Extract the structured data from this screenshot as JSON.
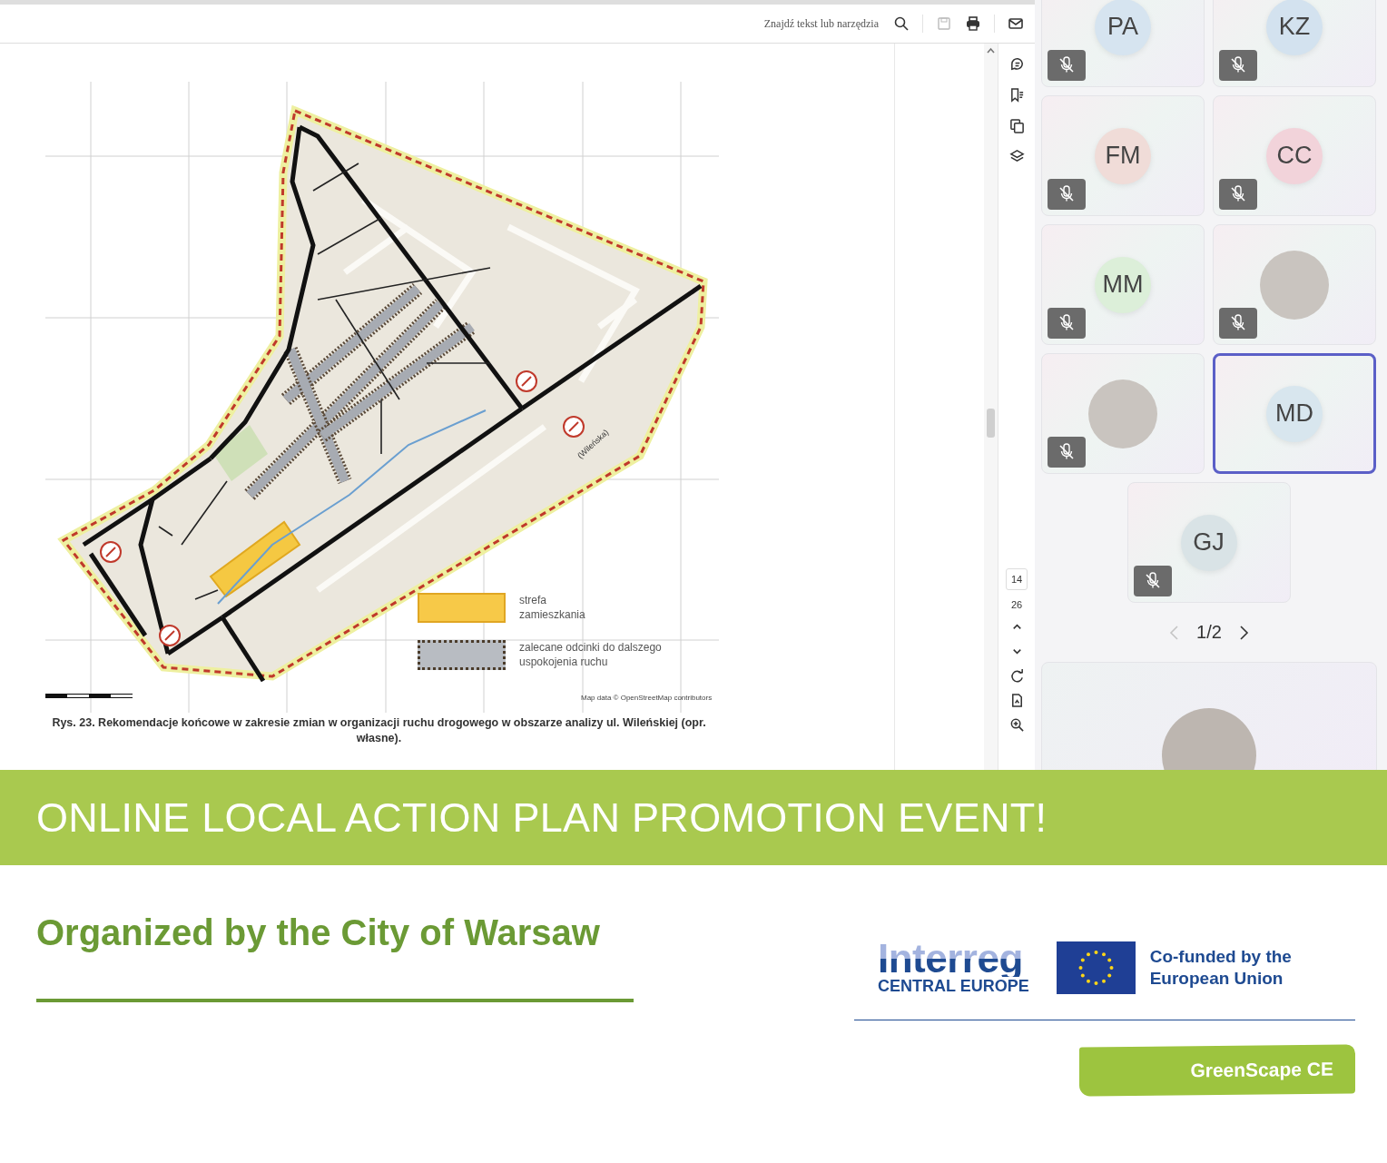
{
  "pdf_viewer": {
    "toolbar": {
      "search_placeholder": "Znajdź tekst lub narzędzia"
    },
    "page_number": "14",
    "page_count": "26",
    "figure": {
      "map_label": "(Wileńska)",
      "legend": [
        {
          "kind": "zone",
          "label": "strefa zamieszkania"
        },
        {
          "kind": "calming",
          "label": "zalecane odcinki do dalszego uspokojenia ruchu"
        }
      ],
      "attribution": "Map data © OpenStreetMap contributors",
      "caption": "Rys. 23. Rekomendacje końcowe w zakresie zmian w organizacji ruchu drogowego w obszarze analizy ul. Wileńskiej (opr. własne)."
    }
  },
  "meeting": {
    "participants": [
      {
        "kind": "initials",
        "initials": "PA",
        "color": "#d6e4f0",
        "muted": true,
        "selected": false
      },
      {
        "kind": "initials",
        "initials": "KZ",
        "color": "#d3e2ef",
        "muted": true,
        "selected": false
      },
      {
        "kind": "initials",
        "initials": "FM",
        "color": "#f0dcd8",
        "muted": true,
        "selected": false
      },
      {
        "kind": "initials",
        "initials": "CC",
        "color": "#f2d3da",
        "muted": true,
        "selected": false
      },
      {
        "kind": "initials",
        "initials": "MM",
        "color": "#dcefd9",
        "muted": true,
        "selected": false
      },
      {
        "kind": "photo",
        "muted": true,
        "selected": false
      },
      {
        "kind": "photo",
        "muted": true,
        "selected": false
      },
      {
        "kind": "initials",
        "initials": "MD",
        "color": "#d8e6ee",
        "muted": false,
        "selected": true
      },
      {
        "kind": "initials",
        "initials": "GJ",
        "color": "#d9e3e6",
        "muted": true,
        "selected": false
      }
    ],
    "pager": {
      "label": "1/2",
      "previous": {
        "disabled": true
      },
      "next": {
        "disabled": false
      }
    },
    "speaker": {
      "kind": "photo"
    }
  },
  "banner": {
    "title": "ONLINE LOCAL ACTION PLAN PROMOTION EVENT!"
  },
  "footer": {
    "organizer": "Organized by the City of Warsaw",
    "interreg": {
      "name": "Interreg",
      "region": "CENTRAL EUROPE"
    },
    "eu_funding": "Co-funded by the European Union",
    "project": "GreenScape CE"
  }
}
